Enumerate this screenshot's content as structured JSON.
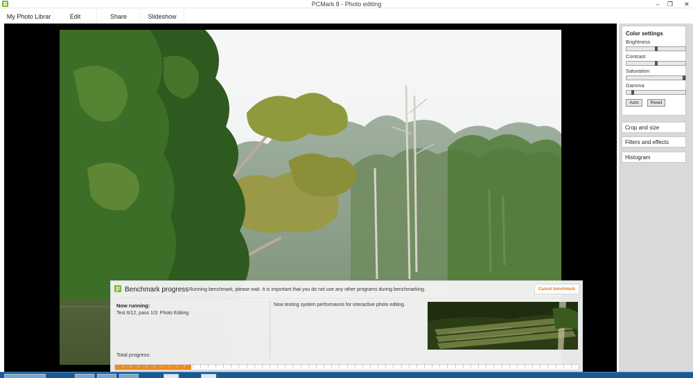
{
  "window": {
    "title": "PCMark 8 - Photo editing",
    "controls": {
      "minimize": "–",
      "restore": "❐",
      "close": "✕"
    }
  },
  "menu": [
    {
      "label": "My Photo Librar"
    },
    {
      "label": "Edit"
    },
    {
      "label": "Share"
    },
    {
      "label": "Slideshow"
    }
  ],
  "panel": {
    "color_settings": {
      "title": "Color settings",
      "sliders": [
        {
          "label": "Brightness",
          "value": 0.5
        },
        {
          "label": "Contrast",
          "value": 0.5
        },
        {
          "label": "Saturation",
          "value": 1.0
        },
        {
          "label": "Gamma",
          "value": 0.1
        }
      ],
      "auto_label": "Auto",
      "reset_label": "Reset"
    },
    "sections": [
      {
        "label": "Crop and size"
      },
      {
        "label": "Filters and effects"
      },
      {
        "label": "Histogram"
      }
    ]
  },
  "benchmark": {
    "title": "Benchmark progress",
    "message": "Running benchmark, please wait. It is important that you do not use any other programs during benchmarking.",
    "cancel_label": "Cancel benchmark",
    "now_running_label": "Now running:",
    "now_running_value": "Test 6/12, pass 1/3: Photo Editing",
    "description": "Now testing system performance for interactive photo editing.",
    "total_progress_label": "Total progress:",
    "total_progress": 0.165
  },
  "colors": {
    "accent": "#f08a1e",
    "brand": "#77b82a",
    "taskbar": "#1a5a93"
  }
}
